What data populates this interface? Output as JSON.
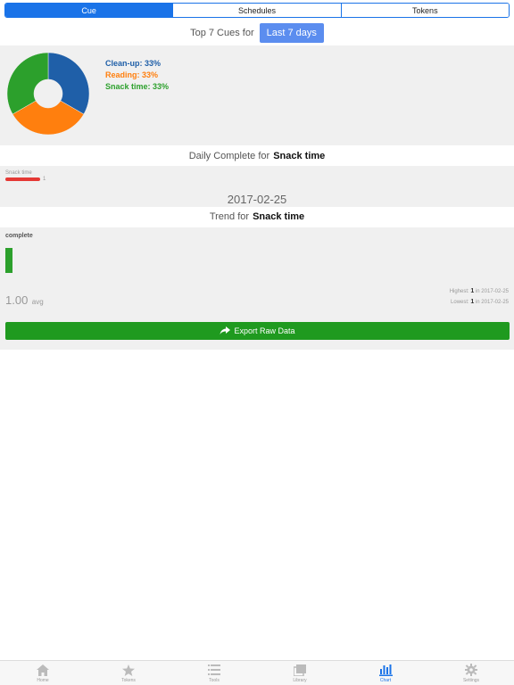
{
  "segments": [
    "Cue",
    "Schedules",
    "Tokens"
  ],
  "active_segment": 0,
  "top_cues": {
    "prefix": "Top 7 Cues for",
    "range_button": "Last 7 days",
    "legend": [
      {
        "label": "Clean-up: 33%",
        "color": "#1f5fa8"
      },
      {
        "label": "Reading: 33%",
        "color": "#ff7f0e"
      },
      {
        "label": "Snack time: 33%",
        "color": "#2ca02c"
      }
    ]
  },
  "chart_data": [
    {
      "type": "pie",
      "style": "donut",
      "categories": [
        "Clean-up",
        "Reading",
        "Snack time"
      ],
      "values": [
        33,
        33,
        33
      ],
      "colors": [
        "#1f5fa8",
        "#ff7f0e",
        "#2ca02c"
      ]
    },
    {
      "type": "bar",
      "orientation": "horizontal",
      "categories": [
        "Snack time"
      ],
      "values": [
        1
      ],
      "colors": [
        "#e53935"
      ]
    },
    {
      "type": "bar",
      "title": "complete",
      "values": [
        1
      ],
      "colors": [
        "#2ca02c"
      ]
    }
  ],
  "daily": {
    "prefix": "Daily Complete for",
    "name": "Snack time",
    "bar_label": "Snack time",
    "bar_value": "1",
    "date": "2017-02-25"
  },
  "trend": {
    "prefix": "Trend for",
    "name": "Snack time",
    "chart_label": "complete",
    "avg_value": "1.00",
    "avg_unit": "avg",
    "highest_label": "Highest:",
    "highest_value": "1",
    "highest_in": "in 2017-02-25",
    "lowest_label": "Lowest:",
    "lowest_value": "1",
    "lowest_in": "in 2017-02-25"
  },
  "export_label": "Export Raw Data",
  "tabs": [
    {
      "label": "Home",
      "icon": "home-icon"
    },
    {
      "label": "Tokens",
      "icon": "star-icon"
    },
    {
      "label": "Tools",
      "icon": "list-icon"
    },
    {
      "label": "Library",
      "icon": "library-icon"
    },
    {
      "label": "Chart",
      "icon": "chart-icon"
    },
    {
      "label": "Settings",
      "icon": "gear-icon"
    }
  ],
  "active_tab": 4
}
